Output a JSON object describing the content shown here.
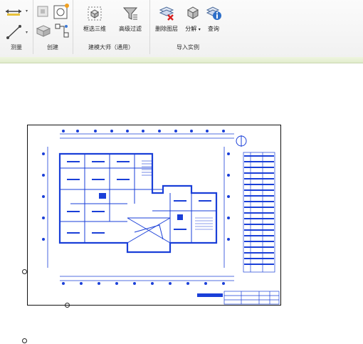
{
  "ribbon": {
    "panels": [
      {
        "title": "测量"
      },
      {
        "title": "创建"
      },
      {
        "title": "建模大师（通用）",
        "buttons": [
          {
            "label": "框选三维"
          },
          {
            "label": "高级过滤"
          }
        ]
      },
      {
        "title": "导入实例",
        "buttons": [
          {
            "label": "删除图层"
          },
          {
            "label": "分解"
          },
          {
            "label": "查询"
          }
        ]
      }
    ]
  },
  "colors": {
    "accent_green": "#e2edcd",
    "drawing_blue": "#1a3fd8",
    "ribbon_bg": "#f4f4f4"
  }
}
